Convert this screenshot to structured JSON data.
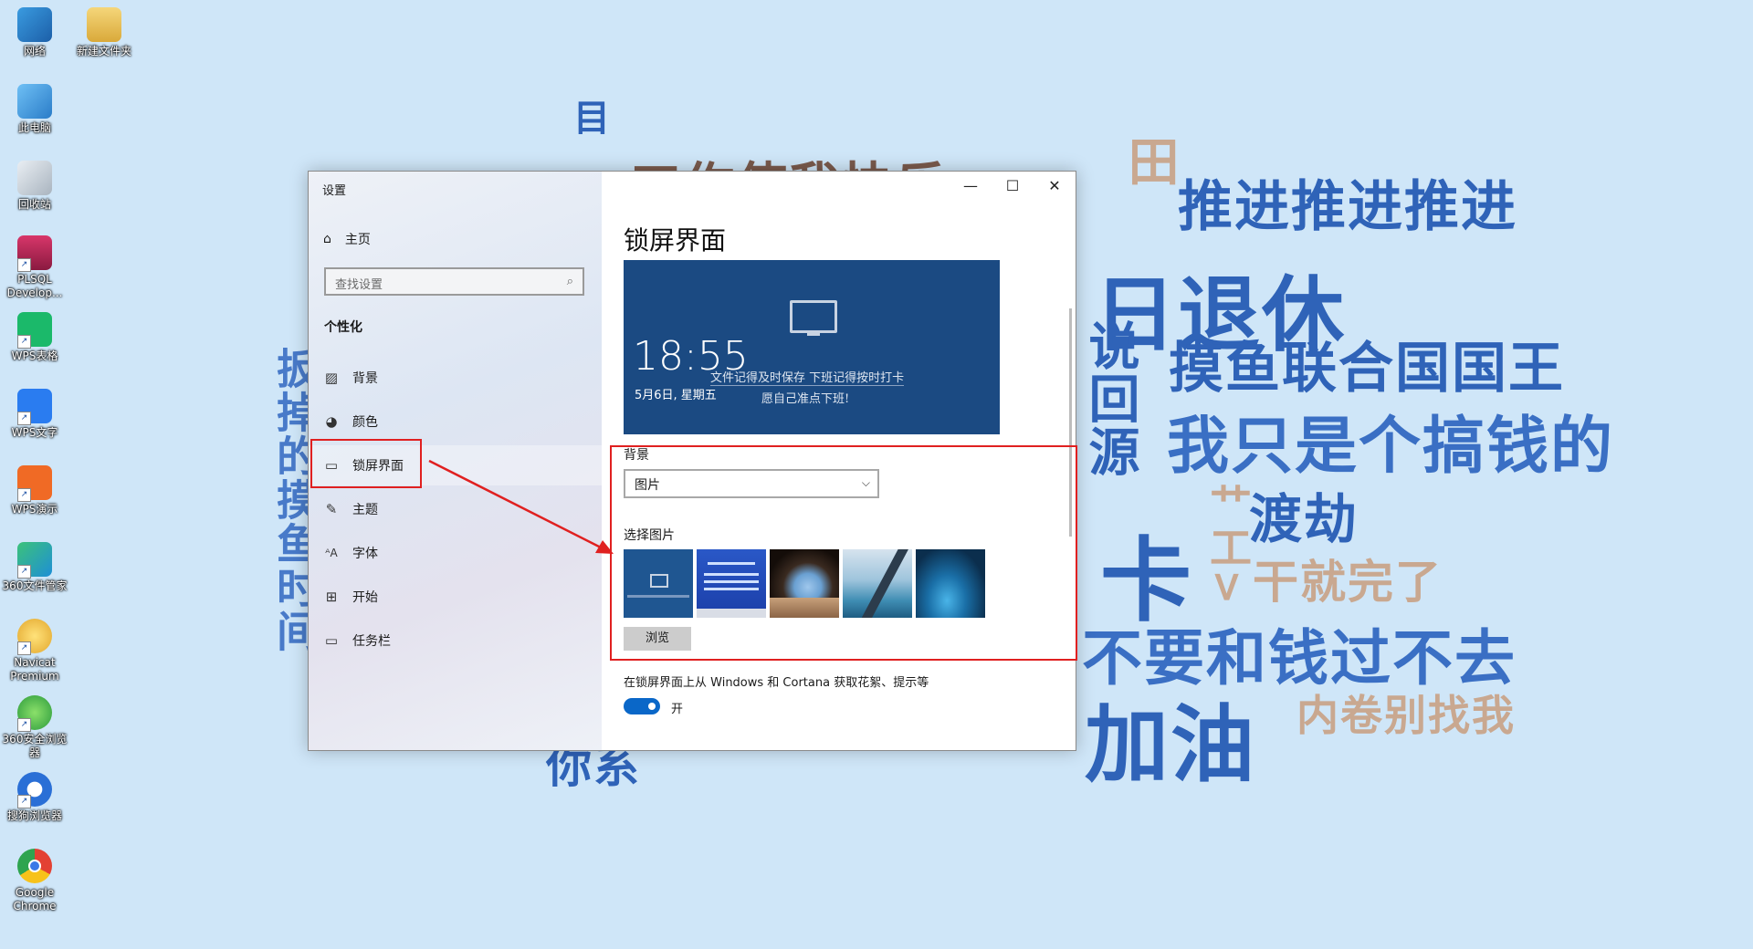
{
  "desktop": {
    "icons": [
      {
        "label": "网络"
      },
      {
        "label": "新建文件夹"
      },
      {
        "label": "此电脑"
      },
      {
        "label": "回收站"
      },
      {
        "label": "PLSQL Develop..."
      },
      {
        "label": "WPS表格"
      },
      {
        "label": "WPS文字"
      },
      {
        "label": "WPS演示"
      },
      {
        "label": "360文件管家"
      },
      {
        "label": "Navicat Premium"
      },
      {
        "label": "360安全浏览器"
      },
      {
        "label": "搜狗浏览器"
      },
      {
        "label": "Google Chrome"
      }
    ],
    "wallpaper_words": [
      "推进推进推进",
      "日退休",
      "摸鱼联合国国王",
      "我只是个搞钱的",
      "渡劫",
      "干就完了",
      "卡",
      "不要和钱过不去",
      "加油",
      "内卷别找我"
    ]
  },
  "settings": {
    "title": "设置",
    "window_controls": {
      "minimize": "—",
      "maximize": "☐",
      "close": "✕"
    },
    "home_label": "主页",
    "search_placeholder": "查找设置",
    "group_label": "个性化",
    "nav": [
      {
        "label": "背景",
        "icon": "image-icon"
      },
      {
        "label": "颜色",
        "icon": "palette-icon"
      },
      {
        "label": "锁屏界面",
        "icon": "lock-screen-icon",
        "active": true
      },
      {
        "label": "主题",
        "icon": "brush-icon"
      },
      {
        "label": "字体",
        "icon": "font-icon"
      },
      {
        "label": "开始",
        "icon": "start-icon"
      },
      {
        "label": "任务栏",
        "icon": "taskbar-icon"
      }
    ],
    "page_title": "锁屏界面",
    "preview": {
      "time": "18:55",
      "date": "5月6日, 星期五",
      "note_line1": "文件记得及时保存 下班记得按时打卡",
      "note_line2": "愿自己准点下班!"
    },
    "background_label": "背景",
    "background_value": "图片",
    "choose_picture_label": "选择图片",
    "browse_label": "浏览",
    "cortana_label": "在锁屏界面上从 Windows 和 Cortana 获取花絮、提示等",
    "toggle_state": "开",
    "toggle_on": true,
    "accent_color": "#0a67c8",
    "annotation_color": "#e02020"
  }
}
